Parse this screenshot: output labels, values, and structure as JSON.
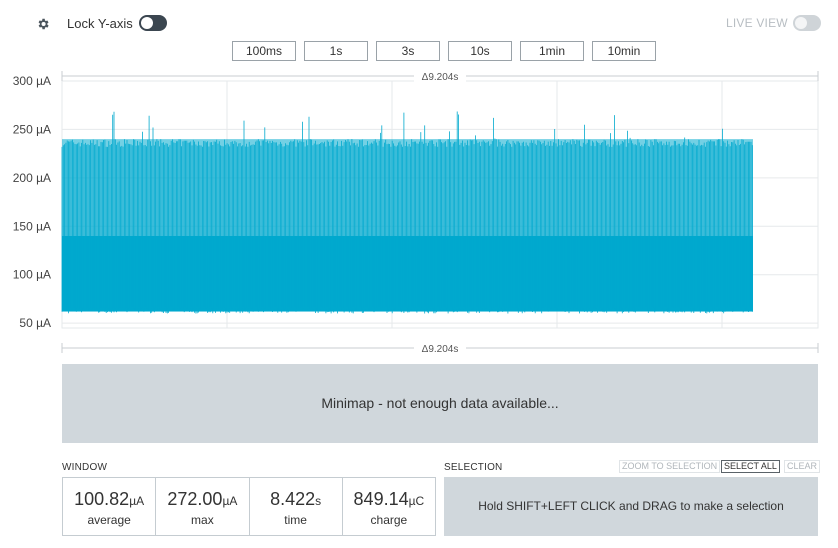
{
  "toolbar": {
    "lock_label": "Lock Y-axis",
    "lock_enabled": false,
    "live_label": "LIVE VIEW",
    "live_enabled": false,
    "window_buttons": [
      "100ms",
      "1s",
      "3s",
      "10s",
      "1min",
      "10min"
    ]
  },
  "chart_data": {
    "type": "line",
    "title": "",
    "xlabel": "",
    "ylabel": "",
    "y_unit": "µA",
    "ylim": [
      45,
      300
    ],
    "y_ticks": [
      "300 µA",
      "250 µA",
      "200 µA",
      "150 µA",
      "100 µA",
      "50 µA"
    ],
    "y_tick_values": [
      300,
      250,
      200,
      150,
      100,
      50
    ],
    "grid": true,
    "series": [
      {
        "color": "#00a9ce",
        "x_range_s": [
          0,
          8.422
        ],
        "baseline_uA": 62,
        "plateau_uA": 240,
        "peak_max_uA": 272,
        "typical_band_uA": [
          62,
          140
        ]
      }
    ],
    "delta_top": "Δ9.204s",
    "delta_bottom": "Δ9.204s"
  },
  "minimap": {
    "message": "Minimap - not enough data available..."
  },
  "window": {
    "label": "WINDOW",
    "stats": [
      {
        "value": "100.82",
        "unit": "µA",
        "label": "average"
      },
      {
        "value": "272.00",
        "unit": "µA",
        "label": "max"
      },
      {
        "value": "8.422",
        "unit": "s",
        "label": "time"
      },
      {
        "value": "849.14",
        "unit": "µC",
        "label": "charge"
      }
    ]
  },
  "selection": {
    "label": "SELECTION",
    "zoom_label": "ZOOM TO SELECTION",
    "select_all_label": "SELECT ALL",
    "clear_label": "CLEAR",
    "hint": "Hold SHIFT+LEFT CLICK and DRAG to make a selection"
  },
  "colors": {
    "trace": "#00a9ce",
    "panel": "#d0d7dc",
    "toggle_on": "#3b4650"
  }
}
